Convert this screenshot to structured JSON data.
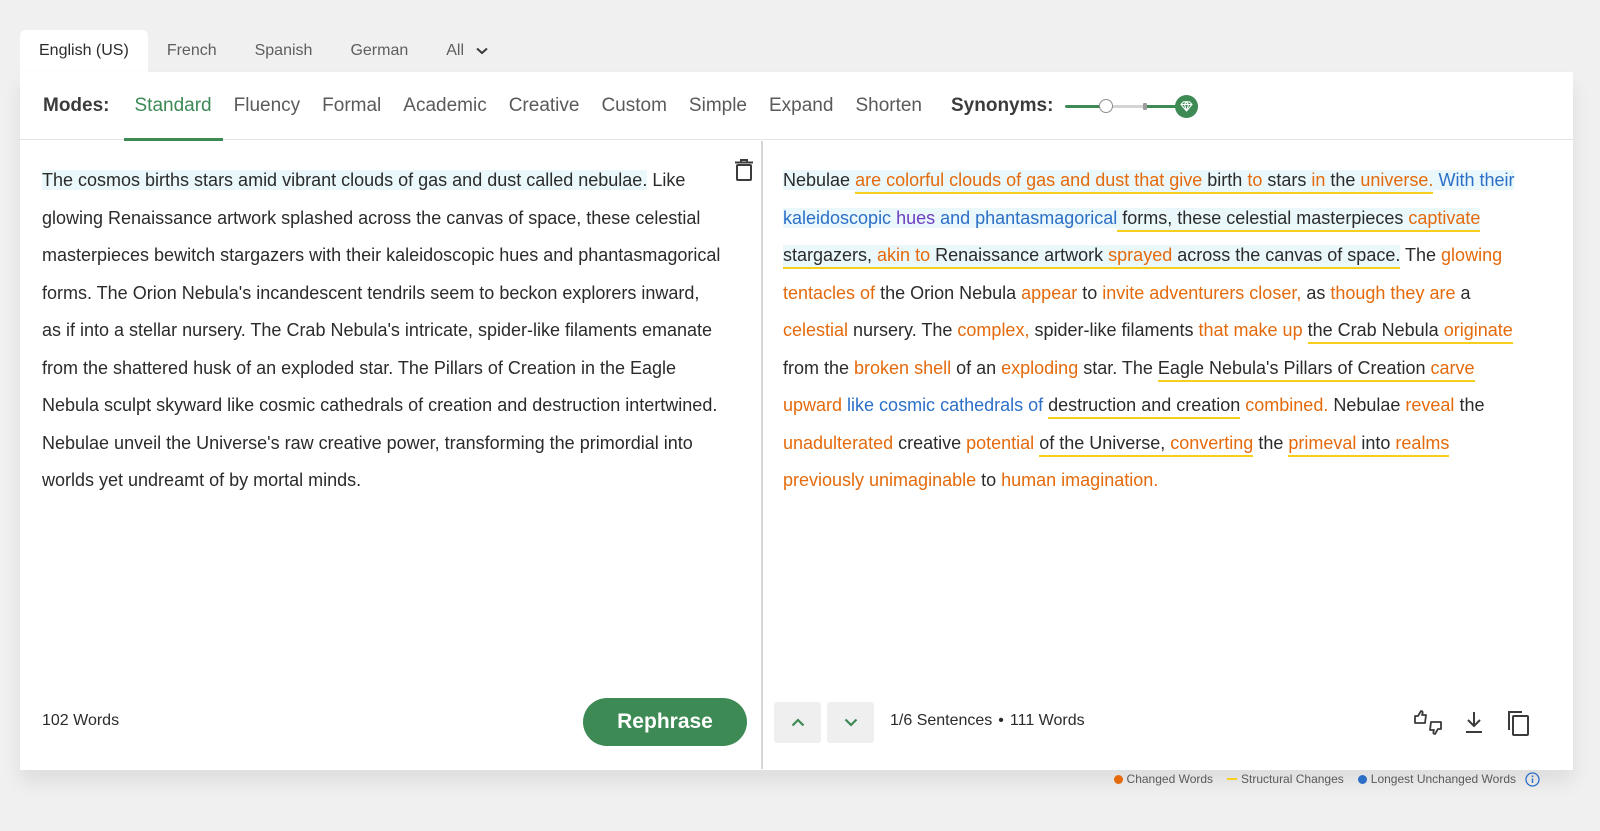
{
  "languages": {
    "tabs": [
      "English (US)",
      "French",
      "Spanish",
      "German",
      "All"
    ],
    "active": "English (US)"
  },
  "modes": {
    "label": "Modes:",
    "items": [
      "Standard",
      "Fluency",
      "Formal",
      "Academic",
      "Creative",
      "Custom",
      "Simple",
      "Expand",
      "Shorten"
    ],
    "active": "Standard"
  },
  "synonyms": {
    "label": "Synonyms:",
    "level": 0.3
  },
  "input": {
    "highlighted_sentence": "The cosmos births stars amid vibrant clouds of gas and dust called nebulae.",
    "rest": " Like glowing Renaissance artwork splashed across the canvas of space, these celestial masterpieces bewitch stargazers with their kaleidoscopic hues and phantasmagorical forms. The Orion Nebula's incandescent tendrils seem to beckon explorers inward, as if into a stellar nursery. The Crab Nebula's intricate, spider-like filaments emanate from the shattered husk of an exploded star. The Pillars of Creation in the Eagle Nebula sculpt skyward like cosmic cathedrals of creation and destruction intertwined. Nebulae unveil the Universe's raw creative power, transforming the primordial into worlds yet undreamt of by mortal minds.",
    "word_count": "102 Words"
  },
  "output": {
    "segments": [
      {
        "t": "Nebulae ",
        "c": "n",
        "bg": true
      },
      {
        "t": "are colorful clouds of gas and dust that give",
        "c": "o",
        "bg": true,
        "u": true
      },
      {
        "t": " birth ",
        "c": "n",
        "bg": true,
        "u": true
      },
      {
        "t": "to",
        "c": "o",
        "bg": true,
        "u": true
      },
      {
        "t": " stars ",
        "c": "n",
        "bg": true,
        "u": true
      },
      {
        "t": "in",
        "c": "o",
        "bg": true,
        "u": true
      },
      {
        "t": " the ",
        "c": "n",
        "bg": true,
        "u": true
      },
      {
        "t": "universe.",
        "c": "o",
        "bg": true,
        "u": true
      },
      {
        "t": " ",
        "c": "n",
        "bg": true
      },
      {
        "t": "With their kaleidoscopic ",
        "c": "b",
        "bg": true
      },
      {
        "t": "hues",
        "c": "p",
        "bg": true
      },
      {
        "t": " and phantasmagorical",
        "c": "b",
        "bg": true
      },
      {
        "t": " forms, these celestial masterpieces ",
        "c": "n",
        "bg": true,
        "u": true
      },
      {
        "t": "captivate",
        "c": "o",
        "bg": true,
        "u": true
      },
      {
        "t": " stargazers, ",
        "c": "n",
        "bg": true,
        "u": true
      },
      {
        "t": "akin to",
        "c": "o",
        "bg": true,
        "u": true
      },
      {
        "t": " Renaissance artwork ",
        "c": "n",
        "bg": true,
        "u": true
      },
      {
        "t": "sprayed",
        "c": "o",
        "bg": true,
        "u": true
      },
      {
        "t": " across the canvas of space.",
        "c": "n",
        "bg": true,
        "u": true
      },
      {
        "t": " The ",
        "c": "n"
      },
      {
        "t": "glowing tentacles of",
        "c": "o"
      },
      {
        "t": " the Orion Nebula ",
        "c": "n"
      },
      {
        "t": "appear",
        "c": "o"
      },
      {
        "t": " to ",
        "c": "n"
      },
      {
        "t": "invite adventurers closer,",
        "c": "o"
      },
      {
        "t": " as ",
        "c": "n"
      },
      {
        "t": "though they are",
        "c": "o"
      },
      {
        "t": " a ",
        "c": "n"
      },
      {
        "t": "celestial",
        "c": "o"
      },
      {
        "t": " nursery. The ",
        "c": "n"
      },
      {
        "t": "complex,",
        "c": "o"
      },
      {
        "t": " spider-like filaments ",
        "c": "n"
      },
      {
        "t": "that make up",
        "c": "o"
      },
      {
        "t": " ",
        "c": "n"
      },
      {
        "t": "the Crab Nebula ",
        "c": "n",
        "u": true
      },
      {
        "t": "originate",
        "c": "o",
        "u": true
      },
      {
        "t": " from the ",
        "c": "n"
      },
      {
        "t": "broken shell",
        "c": "o"
      },
      {
        "t": " of an ",
        "c": "n"
      },
      {
        "t": "exploding",
        "c": "o"
      },
      {
        "t": " star. The ",
        "c": "n"
      },
      {
        "t": "Eagle Nebula's Pillars of Creation ",
        "c": "n",
        "u": true
      },
      {
        "t": "carve",
        "c": "o",
        "u": true
      },
      {
        "t": " upward",
        "c": "o"
      },
      {
        "t": " like cosmic cathedrals of",
        "c": "b"
      },
      {
        "t": " ",
        "c": "n"
      },
      {
        "t": "destruction and creation",
        "c": "n",
        "u": true
      },
      {
        "t": " ",
        "c": "n"
      },
      {
        "t": "combined.",
        "c": "o"
      },
      {
        "t": " Nebulae ",
        "c": "n"
      },
      {
        "t": "reveal",
        "c": "o"
      },
      {
        "t": " the ",
        "c": "n"
      },
      {
        "t": "unadulterated",
        "c": "o"
      },
      {
        "t": " creative ",
        "c": "n"
      },
      {
        "t": "potential",
        "c": "o"
      },
      {
        "t": " ",
        "c": "n"
      },
      {
        "t": "of the Universe, ",
        "c": "n",
        "u": true
      },
      {
        "t": "converting",
        "c": "o",
        "u": true
      },
      {
        "t": " the ",
        "c": "n"
      },
      {
        "t": "primeval",
        "c": "o",
        "u": true
      },
      {
        "t": " into ",
        "c": "n",
        "u": true
      },
      {
        "t": "realms",
        "c": "o",
        "u": true
      },
      {
        "t": " previously unimaginable",
        "c": "o"
      },
      {
        "t": " to ",
        "c": "n"
      },
      {
        "t": "human imagination.",
        "c": "o"
      }
    ]
  },
  "footer": {
    "sentences": "1/6 Sentences",
    "dot": "•",
    "word_count": "111 Words",
    "rephrase_label": "Rephrase"
  },
  "legend": {
    "changed": "Changed Words",
    "structural": "Structural Changes",
    "unchanged": "Longest Unchanged Words"
  },
  "colors": {
    "accent": "#3d8a55",
    "changed": "#e46a0c",
    "structural": "#f5cf1c",
    "unchanged": "#2c6fc7"
  }
}
